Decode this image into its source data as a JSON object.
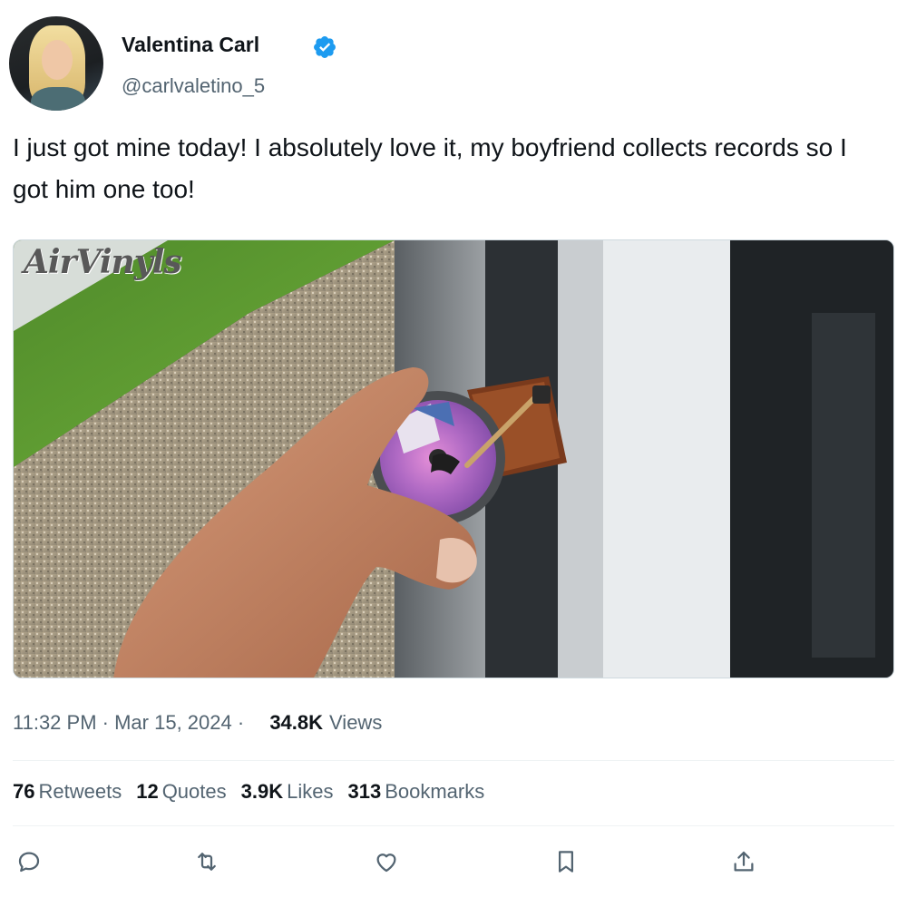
{
  "author": {
    "name": "Valentina Carl",
    "handle": "@carlvaletino_5"
  },
  "tweet": {
    "text": "I just got mine today! I absolutely love it, my boyfriend collects records so I got him one too!"
  },
  "media": {
    "watermark": "AirVinyls"
  },
  "meta": {
    "time": "11:32 PM",
    "sep1": " · ",
    "date": "Mar 15, 2024",
    "sep2": " · ",
    "views_count": "34.8K",
    "views_label": "Views"
  },
  "stats": [
    {
      "num": "76",
      "label": "Retweets"
    },
    {
      "num": "12",
      "label": "Quotes"
    },
    {
      "num": "3.9K",
      "label": "Likes"
    },
    {
      "num": "313",
      "label": "Bookmarks"
    }
  ],
  "colors": {
    "text": "#0f1419",
    "muted": "#536471",
    "verified": "#1d9bf0",
    "divider": "#eff3f4"
  },
  "icons": [
    "reply-icon",
    "retweet-icon",
    "like-icon",
    "bookmark-icon",
    "share-icon",
    "verified-badge-icon"
  ]
}
